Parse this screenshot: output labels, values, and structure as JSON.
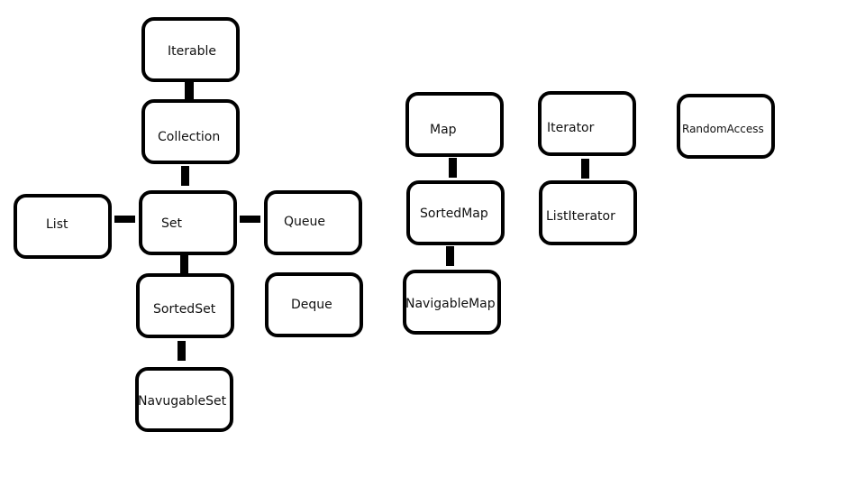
{
  "diagram": {
    "nodes": {
      "iterable": "Iterable",
      "collection": "Collection",
      "set": "Set",
      "list": "List",
      "queue": "Queue",
      "sorted_set": "SortedSet",
      "deque": "Deque",
      "navugable_set": "NavugableSet",
      "map": "Map",
      "sorted_map": "SortedMap",
      "navigable_map": "NavigableMap",
      "iterator": "Iterator",
      "list_iterator": "ListIterator",
      "random_access": "RandomAccess"
    },
    "edges": [
      [
        "Iterable",
        "Collection"
      ],
      [
        "Collection",
        "Set"
      ],
      [
        "List",
        "Set"
      ],
      [
        "Set",
        "Queue"
      ],
      [
        "Set",
        "SortedSet"
      ],
      [
        "SortedSet",
        "NavugableSet"
      ],
      [
        "Map",
        "SortedMap"
      ],
      [
        "SortedMap",
        "NavigableMap"
      ],
      [
        "Iterator",
        "ListIterator"
      ]
    ]
  }
}
